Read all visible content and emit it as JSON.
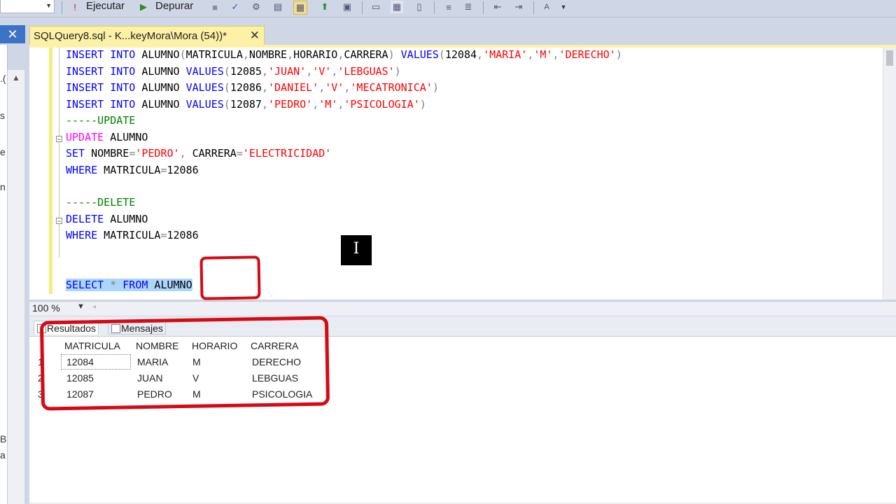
{
  "toolbar": {
    "execute_label": "Ejecutar",
    "debug_label": "Depurar"
  },
  "tab": {
    "title": "SQLQuery8.sql - K...keyMora\\Mora (54))*",
    "close": "✕"
  },
  "left": {
    "close": "✕",
    "fragments": [
      ".(",
      "s",
      "e",
      "n",
      "B",
      "a"
    ]
  },
  "editor": {
    "lines": [
      [
        {
          "t": "INSERT",
          "c": "kw"
        },
        {
          "t": " ",
          "c": "id"
        },
        {
          "t": "INTO",
          "c": "kw"
        },
        {
          "t": " ALUMNO",
          "c": "id"
        },
        {
          "t": "(",
          "c": "op"
        },
        {
          "t": "MATRICULA",
          "c": "id"
        },
        {
          "t": ",",
          "c": "op"
        },
        {
          "t": "NOMBRE",
          "c": "id"
        },
        {
          "t": ",",
          "c": "op"
        },
        {
          "t": "HORARIO",
          "c": "id"
        },
        {
          "t": ",",
          "c": "op"
        },
        {
          "t": "CARRERA",
          "c": "id"
        },
        {
          "t": ") ",
          "c": "op"
        },
        {
          "t": "VALUES",
          "c": "kw"
        },
        {
          "t": "(",
          "c": "op"
        },
        {
          "t": "12084",
          "c": "id"
        },
        {
          "t": ",",
          "c": "op"
        },
        {
          "t": "'MARIA'",
          "c": "str"
        },
        {
          "t": ",",
          "c": "op"
        },
        {
          "t": "'M'",
          "c": "str"
        },
        {
          "t": ",",
          "c": "op"
        },
        {
          "t": "'DERECHO'",
          "c": "str"
        },
        {
          "t": ")",
          "c": "op"
        }
      ],
      [
        {
          "t": "INSERT",
          "c": "kw"
        },
        {
          "t": " ",
          "c": "id"
        },
        {
          "t": "INTO",
          "c": "kw"
        },
        {
          "t": " ALUMNO ",
          "c": "id"
        },
        {
          "t": "VALUES",
          "c": "kw"
        },
        {
          "t": "(",
          "c": "op"
        },
        {
          "t": "12085",
          "c": "id"
        },
        {
          "t": ",",
          "c": "op"
        },
        {
          "t": "'JUAN'",
          "c": "str"
        },
        {
          "t": ",",
          "c": "op"
        },
        {
          "t": "'V'",
          "c": "str"
        },
        {
          "t": ",",
          "c": "op"
        },
        {
          "t": "'LEBGUAS'",
          "c": "str"
        },
        {
          "t": ")",
          "c": "op"
        }
      ],
      [
        {
          "t": "INSERT",
          "c": "kw"
        },
        {
          "t": " ",
          "c": "id"
        },
        {
          "t": "INTO",
          "c": "kw"
        },
        {
          "t": " ALUMNO ",
          "c": "id"
        },
        {
          "t": "VALUES",
          "c": "kw"
        },
        {
          "t": "(",
          "c": "op"
        },
        {
          "t": "12086",
          "c": "id"
        },
        {
          "t": ",",
          "c": "op"
        },
        {
          "t": "'DANIEL'",
          "c": "str"
        },
        {
          "t": ",",
          "c": "op"
        },
        {
          "t": "'V'",
          "c": "str"
        },
        {
          "t": ",",
          "c": "op"
        },
        {
          "t": "'MECATRONICA'",
          "c": "str"
        },
        {
          "t": ")",
          "c": "op"
        }
      ],
      [
        {
          "t": "INSERT",
          "c": "kw"
        },
        {
          "t": " ",
          "c": "id"
        },
        {
          "t": "INTO",
          "c": "kw"
        },
        {
          "t": " ALUMNO ",
          "c": "id"
        },
        {
          "t": "VALUES",
          "c": "kw"
        },
        {
          "t": "(",
          "c": "op"
        },
        {
          "t": "12087",
          "c": "id"
        },
        {
          "t": ",",
          "c": "op"
        },
        {
          "t": "'PEDRO'",
          "c": "str"
        },
        {
          "t": ",",
          "c": "op"
        },
        {
          "t": "'M'",
          "c": "str"
        },
        {
          "t": ",",
          "c": "op"
        },
        {
          "t": "'PSICOLOGIA'",
          "c": "str"
        },
        {
          "t": ")",
          "c": "op"
        }
      ],
      [
        {
          "t": "-----UPDATE",
          "c": "cmt"
        }
      ],
      [
        {
          "t": "UPDATE",
          "c": "kwm"
        },
        {
          "t": " ALUMNO",
          "c": "id"
        }
      ],
      [
        {
          "t": "SET",
          "c": "kw"
        },
        {
          "t": " NOMBRE",
          "c": "id"
        },
        {
          "t": "=",
          "c": "op"
        },
        {
          "t": "'PEDRO'",
          "c": "str"
        },
        {
          "t": ", ",
          "c": "op"
        },
        {
          "t": "CARRERA",
          "c": "id"
        },
        {
          "t": "=",
          "c": "op"
        },
        {
          "t": "'ELECTRICIDAD'",
          "c": "str"
        }
      ],
      [
        {
          "t": "WHERE",
          "c": "kw"
        },
        {
          "t": " MATRICULA",
          "c": "id"
        },
        {
          "t": "=",
          "c": "op"
        },
        {
          "t": "12086",
          "c": "id"
        }
      ],
      [],
      [
        {
          "t": "-----DELETE",
          "c": "cmt"
        }
      ],
      [
        {
          "t": "DELETE",
          "c": "kw"
        },
        {
          "t": " ALUMNO",
          "c": "id"
        }
      ],
      [
        {
          "t": "WHERE",
          "c": "kw"
        },
        {
          "t": " MATRICULA",
          "c": "id"
        },
        {
          "t": "=",
          "c": "op"
        },
        {
          "t": "12086",
          "c": "id"
        }
      ],
      [],
      [],
      [
        {
          "t": "SELECT",
          "c": "kw sel"
        },
        {
          "t": " ",
          "c": "id sel"
        },
        {
          "t": "*",
          "c": "op sel"
        },
        {
          "t": " ",
          "c": "id sel"
        },
        {
          "t": "FROM",
          "c": "kw sel"
        },
        {
          "t": " ALUMNO",
          "c": "id sel"
        }
      ]
    ]
  },
  "cursor_glyph": "I",
  "zoom": {
    "value": "100 %",
    "arrow": "▼",
    "left": "◂"
  },
  "results": {
    "tab_results": "Resultados",
    "tab_messages": "Mensajes",
    "columns": [
      "MATRICULA",
      "NOMBRE",
      "HORARIO",
      "CARRERA"
    ],
    "rows": [
      {
        "n": "1",
        "cells": [
          "12084",
          "MARIA",
          "M",
          "DERECHO"
        ]
      },
      {
        "n": "2",
        "cells": [
          "12085",
          "JUAN",
          "V",
          "LEBGUAS"
        ]
      },
      {
        "n": "3",
        "cells": [
          "12087",
          "PEDRO",
          "M",
          "PSICOLOGIA"
        ]
      }
    ]
  }
}
